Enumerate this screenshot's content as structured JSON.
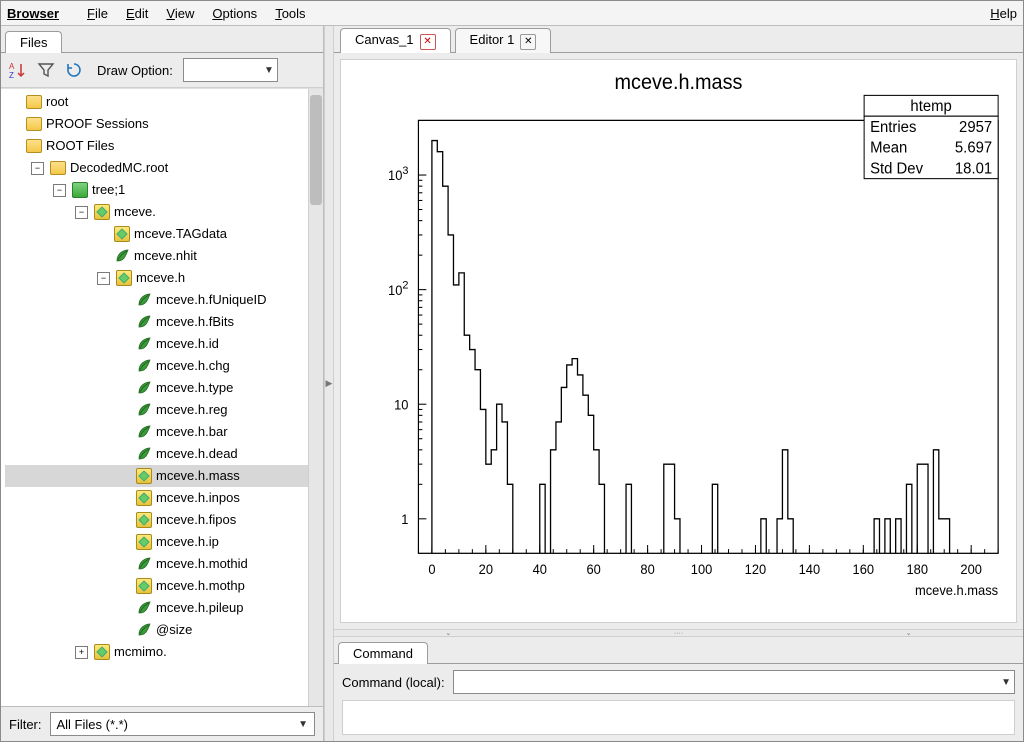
{
  "menu": {
    "brand": "Browser",
    "items": [
      {
        "label": "File",
        "ul": "F"
      },
      {
        "label": "Edit",
        "ul": "E"
      },
      {
        "label": "View",
        "ul": "V"
      },
      {
        "label": "Options",
        "ul": "O"
      },
      {
        "label": "Tools",
        "ul": "T"
      }
    ],
    "help": {
      "label": "Help",
      "ul": "H"
    }
  },
  "left_tab": {
    "label": "Files"
  },
  "toolbar": {
    "draw_label": "Draw Option:"
  },
  "tree": [
    {
      "indent": 0,
      "kind": "folder",
      "label": "root"
    },
    {
      "indent": 0,
      "kind": "folder",
      "label": "PROOF Sessions"
    },
    {
      "indent": 0,
      "kind": "folder",
      "label": "ROOT Files"
    },
    {
      "indent": 1,
      "kind": "file",
      "label": "DecodedMC.root",
      "expander": "-"
    },
    {
      "indent": 2,
      "kind": "tree",
      "label": "tree;1",
      "expander": "-"
    },
    {
      "indent": 3,
      "kind": "branch",
      "label": "mceve.",
      "expander": "-"
    },
    {
      "indent": 4,
      "kind": "branch",
      "label": "mceve.TAGdata"
    },
    {
      "indent": 4,
      "kind": "leaf",
      "label": "mceve.nhit"
    },
    {
      "indent": 4,
      "kind": "branch",
      "label": "mceve.h",
      "expander": "-"
    },
    {
      "indent": 5,
      "kind": "leaf",
      "label": "mceve.h.fUniqueID"
    },
    {
      "indent": 5,
      "kind": "leaf",
      "label": "mceve.h.fBits"
    },
    {
      "indent": 5,
      "kind": "leaf",
      "label": "mceve.h.id"
    },
    {
      "indent": 5,
      "kind": "leaf",
      "label": "mceve.h.chg"
    },
    {
      "indent": 5,
      "kind": "leaf",
      "label": "mceve.h.type"
    },
    {
      "indent": 5,
      "kind": "leaf",
      "label": "mceve.h.reg"
    },
    {
      "indent": 5,
      "kind": "leaf",
      "label": "mceve.h.bar"
    },
    {
      "indent": 5,
      "kind": "leaf",
      "label": "mceve.h.dead"
    },
    {
      "indent": 5,
      "kind": "leaf",
      "label": "mceve.h.mass",
      "selected": true,
      "branchicon": true
    },
    {
      "indent": 5,
      "kind": "branch",
      "label": "mceve.h.inpos"
    },
    {
      "indent": 5,
      "kind": "branch",
      "label": "mceve.h.fipos"
    },
    {
      "indent": 5,
      "kind": "branch",
      "label": "mceve.h.ip"
    },
    {
      "indent": 5,
      "kind": "leaf",
      "label": "mceve.h.mothid"
    },
    {
      "indent": 5,
      "kind": "branch",
      "label": "mceve.h.mothp"
    },
    {
      "indent": 5,
      "kind": "leaf",
      "label": "mceve.h.pileup"
    },
    {
      "indent": 5,
      "kind": "leaf",
      "label": "@size"
    },
    {
      "indent": 3,
      "kind": "branch",
      "label": "mcmimo.",
      "expander": "+"
    }
  ],
  "filter": {
    "label": "Filter:",
    "value": "All Files (*.*)"
  },
  "right_tabs": [
    {
      "label": "Canvas_1",
      "active": true,
      "close": "red"
    },
    {
      "label": "Editor 1",
      "active": false,
      "close": "grey"
    }
  ],
  "stats": {
    "name": "htemp",
    "rows": [
      {
        "k": "Entries",
        "v": "2957"
      },
      {
        "k": "Mean",
        "v": "5.697"
      },
      {
        "k": "Std Dev",
        "v": "18.01"
      }
    ]
  },
  "command": {
    "tab": "Command",
    "label": "Command (local):"
  },
  "chart_data": {
    "type": "bar",
    "title": "mceve.h.mass",
    "xlabel": "mceve.h.mass",
    "ylabel": "",
    "xlim": [
      -5,
      210
    ],
    "ylim": [
      0.5,
      3000
    ],
    "yscale": "log",
    "xticks": [
      0,
      20,
      40,
      60,
      80,
      100,
      120,
      140,
      160,
      180,
      200
    ],
    "binwidth": 2,
    "bins": [
      {
        "x": 0,
        "y": 2000
      },
      {
        "x": 2,
        "y": 1600
      },
      {
        "x": 4,
        "y": 800
      },
      {
        "x": 6,
        "y": 300
      },
      {
        "x": 8,
        "y": 110
      },
      {
        "x": 10,
        "y": 140
      },
      {
        "x": 12,
        "y": 40
      },
      {
        "x": 14,
        "y": 30
      },
      {
        "x": 16,
        "y": 20
      },
      {
        "x": 18,
        "y": 9
      },
      {
        "x": 20,
        "y": 3
      },
      {
        "x": 22,
        "y": 4
      },
      {
        "x": 24,
        "y": 10
      },
      {
        "x": 26,
        "y": 7
      },
      {
        "x": 28,
        "y": 2
      },
      {
        "x": 40,
        "y": 2
      },
      {
        "x": 44,
        "y": 4
      },
      {
        "x": 46,
        "y": 7
      },
      {
        "x": 48,
        "y": 14
      },
      {
        "x": 50,
        "y": 22
      },
      {
        "x": 52,
        "y": 25
      },
      {
        "x": 54,
        "y": 18
      },
      {
        "x": 56,
        "y": 12
      },
      {
        "x": 58,
        "y": 8
      },
      {
        "x": 60,
        "y": 4
      },
      {
        "x": 62,
        "y": 2
      },
      {
        "x": 72,
        "y": 2
      },
      {
        "x": 86,
        "y": 3
      },
      {
        "x": 88,
        "y": 3
      },
      {
        "x": 90,
        "y": 1
      },
      {
        "x": 104,
        "y": 2
      },
      {
        "x": 122,
        "y": 1
      },
      {
        "x": 128,
        "y": 1
      },
      {
        "x": 130,
        "y": 4
      },
      {
        "x": 132,
        "y": 1
      },
      {
        "x": 164,
        "y": 1
      },
      {
        "x": 168,
        "y": 1
      },
      {
        "x": 172,
        "y": 1
      },
      {
        "x": 176,
        "y": 2
      },
      {
        "x": 180,
        "y": 3
      },
      {
        "x": 182,
        "y": 3
      },
      {
        "x": 186,
        "y": 4
      },
      {
        "x": 188,
        "y": 1
      },
      {
        "x": 190,
        "y": 1
      }
    ]
  }
}
